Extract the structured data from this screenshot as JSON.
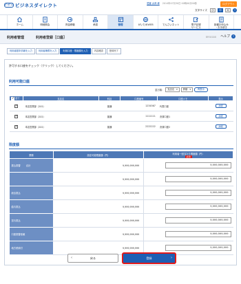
{
  "header": {
    "logo_mark": "ｶﾞｲﾀﾞﾝｽ",
    "logo_text": "ビジネスダイレクト",
    "user_name": "愛媛 太郎 様",
    "last_login": "2014年07月30日 00時00分00秒",
    "logout_label": "ログアウト",
    "text_size_label": "文字サイズ",
    "size_options": [
      "小",
      "中",
      "大"
    ],
    "size_selected_index": 1,
    "help_icon_text": "?"
  },
  "nav": {
    "items": [
      {
        "label": "ホーム",
        "icon": "house-icon"
      },
      {
        "label": "明細照会",
        "icon": "document-icon"
      },
      {
        "label": "資金移動",
        "icon": "transfer-icon"
      },
      {
        "label": "承認",
        "icon": "stamp-icon"
      },
      {
        "label": "管理",
        "icon": "gear-icon"
      },
      {
        "label": "がいためWEB",
        "icon": "globe-icon"
      },
      {
        "label": "でんさいネット",
        "icon": "network-icon"
      },
      {
        "label": "電子記録\nサービス",
        "icon": "edit-icon"
      },
      {
        "label": "各種お申込み\n・お手続き",
        "icon": "form-icon"
      }
    ],
    "active_index": 4
  },
  "page": {
    "category": "利用者管理",
    "title": "利用者登録［口座］",
    "screen_code": "BRSK008",
    "help_label": "ヘルプ"
  },
  "steps": [
    "利用者基本情報を入力",
    "利用者権限を入力",
    "利用口座・限度額を入力",
    "内容確認",
    "登録完了"
  ],
  "steps_current_index": 2,
  "message": "許可する口座をチェック（クリック）してください。",
  "accounts_section": {
    "title": "利用可能口座",
    "sort_label": "並び順：",
    "sort_value": "支店名",
    "order_value": "昇順",
    "resort_label": "再表示",
    "columns": [
      "全て",
      "支店名",
      "科目",
      "口座番号",
      "口座メモ",
      "表示"
    ],
    "rows": [
      {
        "checked": true,
        "branch": "本店営業部（201）",
        "type": "普通",
        "number": "1234567",
        "memo": "代表口座",
        "action": "詳細"
      },
      {
        "checked": true,
        "branch": "本店営業部（201）",
        "type": "普通",
        "number": "1111111",
        "memo": "決済口座1",
        "action": "詳細"
      },
      {
        "checked": true,
        "branch": "本店営業部（201）",
        "type": "普通",
        "number": "2222222",
        "memo": "決済口座2",
        "action": "詳細"
      }
    ]
  },
  "limits_section": {
    "title": "限度額",
    "columns": [
      "業務",
      "設定可能限度額（円）",
      "利用者一回当たり限度額（円）"
    ],
    "required_label": "必須",
    "rows": [
      {
        "business": "振込振替",
        "sub": "合計",
        "max": "9,999,999,999",
        "value": "9,999,999,999"
      },
      {
        "business": "",
        "sub": "",
        "max": "9,999,999,999",
        "value": "9,999,999,999"
      },
      {
        "business": "総合振込",
        "sub": "",
        "max": "9,999,999,999",
        "value": "9,999,999,999"
      },
      {
        "business": "給与振込",
        "sub": "",
        "max": "9,999,999,999",
        "value": "9,999,999,999"
      },
      {
        "business": "賞与振込",
        "sub": "",
        "max": "9,999,999,999",
        "value": "9,999,999,999"
      },
      {
        "business": "口座振替依頼",
        "sub": "",
        "max": "9,999,999,999",
        "value": "9,999,999,999"
      },
      {
        "business": "地方税納付",
        "sub": "",
        "max": "9,999,999,999",
        "value": "9,999,999,999"
      }
    ]
  },
  "footer": {
    "back_label": "戻る",
    "register_label": "登録"
  }
}
